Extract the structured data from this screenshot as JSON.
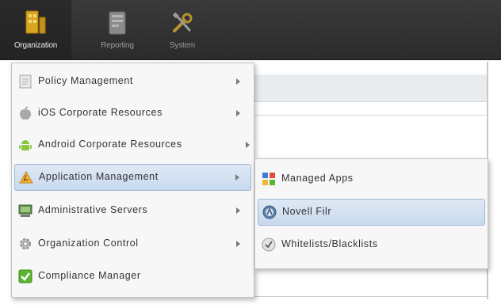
{
  "toolbar": {
    "organization_label": "Organization",
    "reporting_label": "Reporting",
    "system_label": "System"
  },
  "main_menu": {
    "items": [
      {
        "label": "Policy Management",
        "icon": "document-icon",
        "has_submenu": true
      },
      {
        "label": "iOS Corporate Resources",
        "icon": "apple-icon",
        "has_submenu": true
      },
      {
        "label": "Android Corporate Resources",
        "icon": "android-icon",
        "has_submenu": true
      },
      {
        "label": "Application Management",
        "icon": "app-store-icon",
        "has_submenu": true,
        "active": true
      },
      {
        "label": "Administrative Servers",
        "icon": "server-icon",
        "has_submenu": true
      },
      {
        "label": "Organization Control",
        "icon": "gear-icon",
        "has_submenu": true
      },
      {
        "label": "Compliance Manager",
        "icon": "checkmark-icon",
        "has_submenu": false
      }
    ]
  },
  "submenu": {
    "items": [
      {
        "label": "Managed Apps",
        "icon": "apps-grid-icon"
      },
      {
        "label": "Novell Filr",
        "icon": "filr-icon",
        "active": true
      },
      {
        "label": "Whitelists/Blacklists",
        "icon": "shield-icon"
      }
    ]
  },
  "colors": {
    "toolbar_bg": "#2f2f2f",
    "menu_bg": "#f7f7f7",
    "highlight": "#c8d9ee"
  }
}
